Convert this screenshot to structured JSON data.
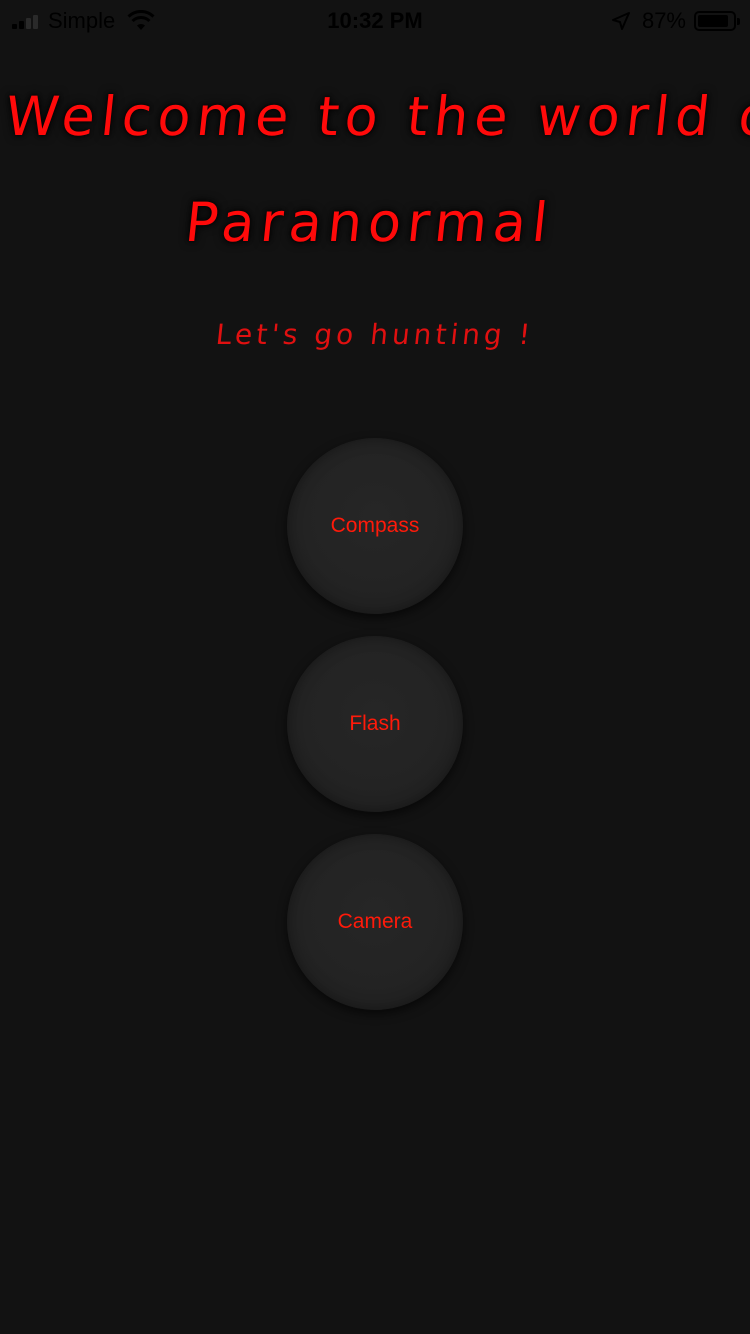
{
  "status_bar": {
    "carrier": "Simple",
    "time": "10:32 PM",
    "battery_percent": "87%",
    "battery_level": 0.87,
    "icons": [
      "signal-icon",
      "wifi-icon",
      "location-arrow-icon",
      "battery-icon"
    ]
  },
  "header": {
    "title_line1": "Welcome to the world of",
    "title_line2": "Paranormal",
    "subtitle": "Let's go hunting !"
  },
  "actions": {
    "compass_label": "Compass",
    "flash_label": "Flash",
    "camera_label": "Camera"
  },
  "colors": {
    "background": "#121212",
    "accent": "#ff0a0a",
    "button_bg": "#232323"
  }
}
